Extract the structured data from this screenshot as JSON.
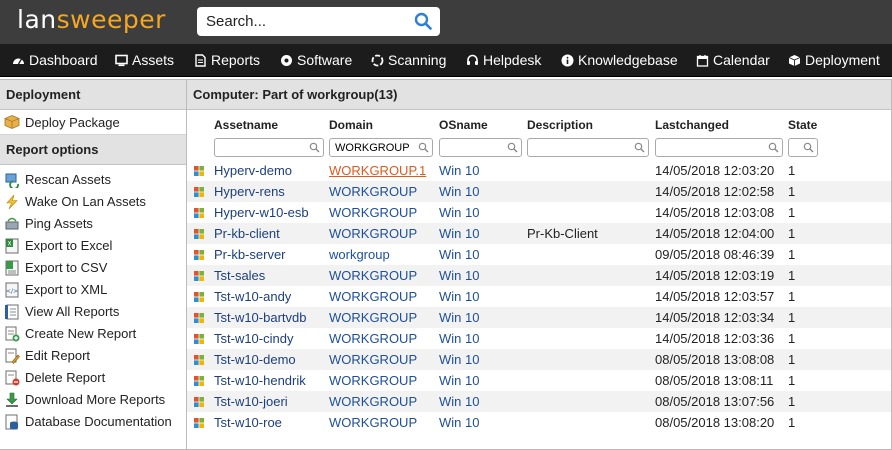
{
  "app": {
    "logo_main": "lan",
    "logo_accent": "sweeper",
    "search_placeholder": "Search..."
  },
  "nav": [
    {
      "label": "Dashboard",
      "icon": "dashboard-icon"
    },
    {
      "label": "Assets",
      "icon": "monitor-icon"
    },
    {
      "label": "Reports",
      "icon": "report-icon"
    },
    {
      "label": "Software",
      "icon": "software-icon"
    },
    {
      "label": "Scanning",
      "icon": "scanning-icon"
    },
    {
      "label": "Helpdesk",
      "icon": "headset-icon"
    },
    {
      "label": "Knowledgebase",
      "icon": "info-icon"
    },
    {
      "label": "Calendar",
      "icon": "calendar-icon"
    },
    {
      "label": "Deployment",
      "icon": "package-icon"
    }
  ],
  "sidebar": {
    "deployment_title": "Deployment",
    "deploy_package": "Deploy Package",
    "report_options_title": "Report options",
    "items": [
      {
        "label": "Rescan Assets",
        "icon": "rescan-icon"
      },
      {
        "label": "Wake On Lan Assets",
        "icon": "lightning-icon"
      },
      {
        "label": "Ping Assets",
        "icon": "ping-icon"
      },
      {
        "label": "Export to Excel",
        "icon": "excel-icon"
      },
      {
        "label": "Export to CSV",
        "icon": "csv-icon"
      },
      {
        "label": "Export to XML",
        "icon": "xml-icon"
      },
      {
        "label": "View All Reports",
        "icon": "reports-list-icon"
      },
      {
        "label": "Create New Report",
        "icon": "create-report-icon"
      },
      {
        "label": "Edit Report",
        "icon": "edit-report-icon"
      },
      {
        "label": "Delete Report",
        "icon": "delete-report-icon"
      },
      {
        "label": "Download More Reports",
        "icon": "download-icon"
      },
      {
        "label": "Database Documentation",
        "icon": "database-icon"
      }
    ]
  },
  "report": {
    "title": "Computer: Part of workgroup(13)",
    "columns": {
      "assetname": "Assetname",
      "domain": "Domain",
      "osname": "OSname",
      "description": "Description",
      "lastchanged": "Lastchanged",
      "state": "State"
    },
    "filters": {
      "assetname": "",
      "domain": "WORKGROUP",
      "osname": "",
      "description": "",
      "lastchanged": "",
      "state": ""
    },
    "rows": [
      {
        "assetname": "Hyperv-demo",
        "domain": "WORKGROUP.1",
        "osname": "Win 10",
        "description": "",
        "lastchanged": "14/05/2018 12:03:20",
        "state": "1"
      },
      {
        "assetname": "Hyperv-rens",
        "domain": "WORKGROUP",
        "osname": "Win 10",
        "description": "",
        "lastchanged": "14/05/2018 12:02:58",
        "state": "1"
      },
      {
        "assetname": "Hyperv-w10-esb",
        "domain": "WORKGROUP",
        "osname": "Win 10",
        "description": "",
        "lastchanged": "14/05/2018 12:03:08",
        "state": "1"
      },
      {
        "assetname": "Pr-kb-client",
        "domain": "WORKGROUP",
        "osname": "Win 10",
        "description": "Pr-Kb-Client",
        "lastchanged": "14/05/2018 12:04:00",
        "state": "1"
      },
      {
        "assetname": "Pr-kb-server",
        "domain": "workgroup",
        "osname": "Win 10",
        "description": "",
        "lastchanged": "09/05/2018 08:46:39",
        "state": "1"
      },
      {
        "assetname": "Tst-sales",
        "domain": "WORKGROUP",
        "osname": "Win 10",
        "description": "",
        "lastchanged": "14/05/2018 12:03:19",
        "state": "1"
      },
      {
        "assetname": "Tst-w10-andy",
        "domain": "WORKGROUP",
        "osname": "Win 10",
        "description": "",
        "lastchanged": "14/05/2018 12:03:57",
        "state": "1"
      },
      {
        "assetname": "Tst-w10-bartvdb",
        "domain": "WORKGROUP",
        "osname": "Win 10",
        "description": "",
        "lastchanged": "14/05/2018 12:03:34",
        "state": "1"
      },
      {
        "assetname": "Tst-w10-cindy",
        "domain": "WORKGROUP",
        "osname": "Win 10",
        "description": "",
        "lastchanged": "14/05/2018 12:03:36",
        "state": "1"
      },
      {
        "assetname": "Tst-w10-demo",
        "domain": "WORKGROUP",
        "osname": "Win 10",
        "description": "",
        "lastchanged": "08/05/2018 13:08:08",
        "state": "1"
      },
      {
        "assetname": "Tst-w10-hendrik",
        "domain": "WORKGROUP",
        "osname": "Win 10",
        "description": "",
        "lastchanged": "08/05/2018 13:08:11",
        "state": "1"
      },
      {
        "assetname": "Tst-w10-joeri",
        "domain": "WORKGROUP",
        "osname": "Win 10",
        "description": "",
        "lastchanged": "08/05/2018 13:07:56",
        "state": "1"
      },
      {
        "assetname": "Tst-w10-roe",
        "domain": "WORKGROUP",
        "osname": "Win 10",
        "description": "",
        "lastchanged": "08/05/2018 13:08:20",
        "state": "1"
      }
    ]
  },
  "colors": {
    "topbar": "#3d3d3d",
    "nav": "#1c1c1c",
    "logo_accent": "#f5a623",
    "link": "#1d3f7c",
    "link_hover": "#e05a1e",
    "search_icon": "#2f7fd6"
  }
}
